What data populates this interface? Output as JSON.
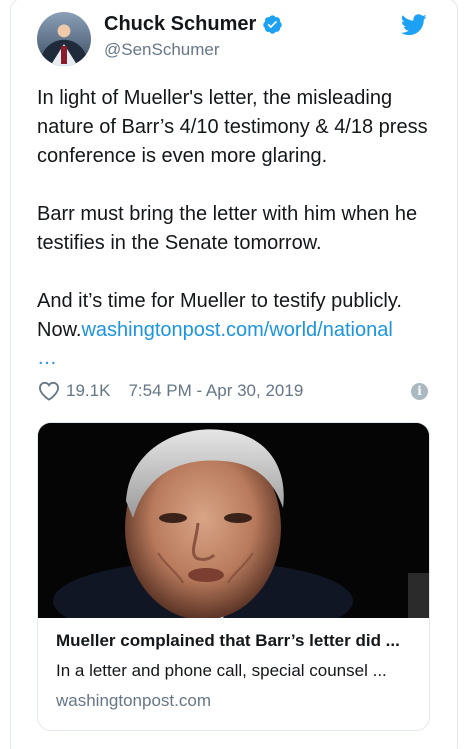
{
  "author": {
    "display_name": "Chuck Schumer",
    "handle": "@SenSchumer",
    "verified": true
  },
  "tweet": {
    "paragraphs": [
      "In light of Mueller's letter, the misleading nature of Barr’s 4/10 testimony & 4/18 press conference is even more glaring.",
      "Barr must bring the letter with him when he testifies in the Senate tomorrow.",
      "And it’s time for Mueller to testify publicly. Now."
    ],
    "link_text": "washingtonpost.com/world/national",
    "link_ellipsis": "…"
  },
  "meta": {
    "likes": "19.1K",
    "timestamp": "7:54 PM - Apr 30, 2019"
  },
  "link_card": {
    "title": "Mueller complained that Barr’s letter did ...",
    "description": "In a letter and phone call, special counsel ...",
    "domain": "washingtonpost.com"
  },
  "icons": {
    "verified": "verified-badge-icon",
    "brand": "twitter-bird-icon",
    "like": "heart-icon",
    "info": "info-icon"
  },
  "colors": {
    "link": "#1b95e0",
    "verified": "#1da1f2",
    "secondary_text": "#657786"
  }
}
